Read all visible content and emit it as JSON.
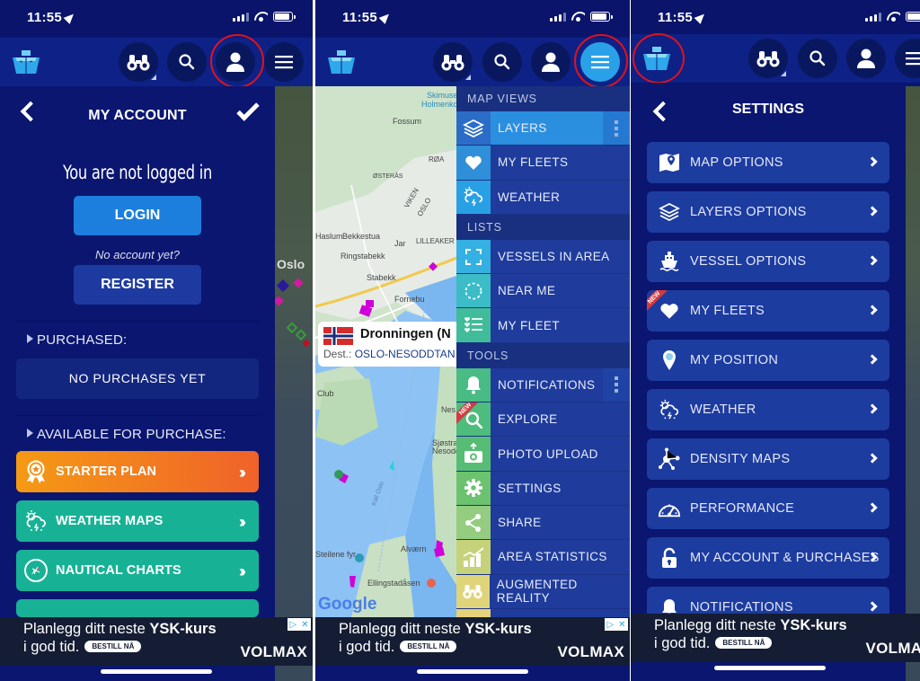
{
  "status_bar": {
    "time": "11:55"
  },
  "toolbar": {
    "buttons": [
      "binoculars",
      "search",
      "account",
      "menu"
    ]
  },
  "panel_account": {
    "title": "MY ACCOUNT",
    "not_logged_in": "You are not logged in",
    "login_label": "LOGIN",
    "no_account": "No account yet?",
    "register_label": "REGISTER",
    "purchased_heading": "PURCHASED:",
    "no_purchases": "NO PURCHASES YET",
    "available_heading": "AVAILABLE FOR PURCHASE:",
    "plans": [
      {
        "label": "STARTER PLAN",
        "icon": "award-ribbon-icon",
        "color": "#f5841f"
      },
      {
        "label": "WEATHER MAPS",
        "icon": "weather-storm-icon",
        "color": "#17b296"
      },
      {
        "label": "NAUTICAL CHARTS",
        "icon": "compass-icon",
        "color": "#17b296"
      }
    ],
    "map_label": "Oslo"
  },
  "panel_menu": {
    "sections": [
      {
        "title": "MAP VIEWS",
        "items": [
          {
            "label": "LAYERS",
            "icon": "layers-icon",
            "selected": true,
            "has_more": true,
            "color": "#2b6dc6"
          },
          {
            "label": "MY FLEETS",
            "icon": "heart-icon",
            "color": "#2f8fd8"
          },
          {
            "label": "WEATHER",
            "icon": "weather-storm-icon",
            "color": "#2aa0e4"
          }
        ]
      },
      {
        "title": "LISTS",
        "items": [
          {
            "label": "VESSELS IN AREA",
            "icon": "expand-frame-icon",
            "color": "#34b0e2"
          },
          {
            "label": "NEAR ME",
            "icon": "dashed-circle-icon",
            "color": "#3bbcc6"
          },
          {
            "label": "MY FLEET",
            "icon": "list-heart-icon",
            "color": "#41bc9a"
          }
        ]
      },
      {
        "title": "TOOLS",
        "items": [
          {
            "label": "NOTIFICATIONS",
            "icon": "bell-icon",
            "has_more": true,
            "color": "#48bc84"
          },
          {
            "label": "EXPLORE",
            "icon": "search-icon",
            "is_new": true,
            "color": "#4ebc7c"
          },
          {
            "label": "PHOTO UPLOAD",
            "icon": "camera-upload-icon",
            "color": "#58bd74"
          },
          {
            "label": "SETTINGS",
            "icon": "gear-icon",
            "color": "#6dc270"
          },
          {
            "label": "SHARE",
            "icon": "share-icon",
            "color": "#94cc80"
          },
          {
            "label": "AREA STATISTICS",
            "icon": "bar-chart-icon",
            "color": "#c6d27a"
          },
          {
            "label": "AUGMENTED REALITY",
            "icon": "binoculars-icon",
            "color": "#e0d47a"
          }
        ]
      }
    ],
    "new_badge": "NEW",
    "vessel_popup": {
      "name": "Dronningen (N",
      "dest_label": "Dest.:",
      "dest_value": "OSLO-NESODDTAN"
    },
    "map_labels": [
      "Skimuse",
      "Holmenkol",
      "Fossum",
      "ØSTERÅS",
      "VIKEN",
      "OSLO",
      "RØA",
      "Haslum",
      "Bekkestua",
      "Jar",
      "LILLEAKER",
      "Ringstabekk",
      "Stabekk",
      "Fornebu",
      "Club",
      "Nes",
      "Sjøstra",
      "Nesodd",
      "Alværn",
      "Steilene fyr",
      "Ellingstadåsen",
      "Kall Oslo"
    ],
    "google_label": "Google"
  },
  "panel_settings": {
    "title": "SETTINGS",
    "items": [
      {
        "label": "MAP OPTIONS",
        "icon": "map-pin-icon"
      },
      {
        "label": "LAYERS OPTIONS",
        "icon": "layers-icon"
      },
      {
        "label": "VESSEL OPTIONS",
        "icon": "ship-icon"
      },
      {
        "label": "MY FLEETS",
        "icon": "heart-icon",
        "is_new": true
      },
      {
        "label": "MY POSITION",
        "icon": "location-pin-icon"
      },
      {
        "label": "WEATHER",
        "icon": "weather-storm-icon"
      },
      {
        "label": "DENSITY MAPS",
        "icon": "network-icon"
      },
      {
        "label": "PERFORMANCE",
        "icon": "speedometer-icon"
      },
      {
        "label": "MY ACCOUNT & PURCHASES",
        "icon": "lock-icon"
      },
      {
        "label": "NOTIFICATIONS",
        "icon": "bell-icon"
      }
    ],
    "new_badge": "NEW"
  },
  "ad": {
    "line1_prefix": "Planlegg ditt neste ",
    "line1_bold": "YSK-kurs",
    "line2": "i god tid.",
    "cta": "BESTILL NÅ",
    "brand": "VOLMAX"
  },
  "colors": {
    "navy": "#0a1670",
    "toolbar": "#0e2186",
    "accent_blue": "#2aa0e8",
    "highlight_ring": "#e0121a"
  }
}
